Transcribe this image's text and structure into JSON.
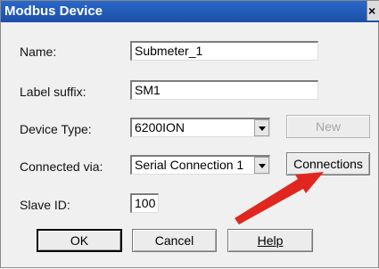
{
  "window": {
    "title": "Modbus Device",
    "close_glyph": "×"
  },
  "fields": {
    "name": {
      "label": "Name:",
      "value": "Submeter_1"
    },
    "label_suffix": {
      "label": "Label suffix:",
      "value": "SM1"
    },
    "device_type": {
      "label": "Device Type:",
      "value": "6200ION"
    },
    "connected_via": {
      "label": "Connected via:",
      "value": "Serial Connection 1"
    },
    "slave_id": {
      "label": "Slave ID:",
      "value": "100"
    }
  },
  "buttons": {
    "new": "New",
    "connections": "Connections",
    "ok": "OK",
    "cancel": "Cancel",
    "help": "Help"
  },
  "annotation": {
    "arrow_color": "#e0261f",
    "icon": "red-arrow-icon"
  }
}
